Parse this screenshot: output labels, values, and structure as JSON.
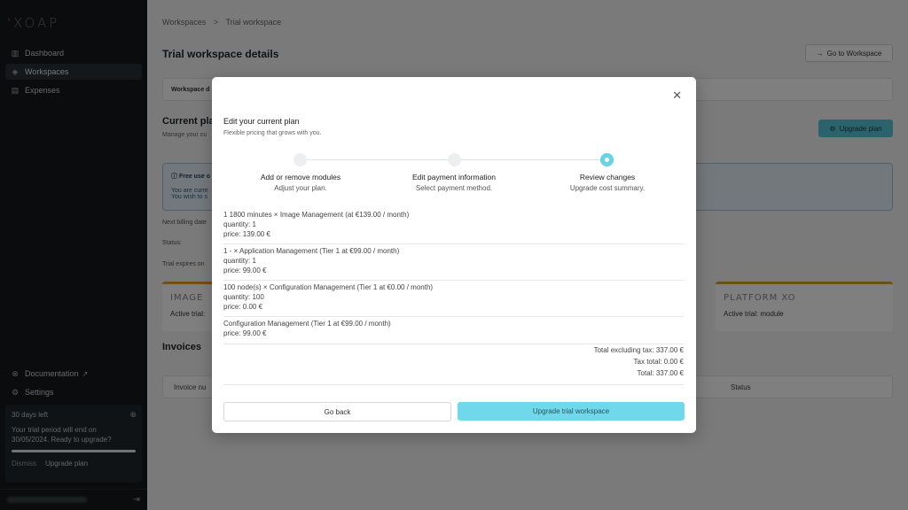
{
  "app": {
    "logo": "XOAP"
  },
  "sidebar": {
    "items": [
      {
        "label": "Dashboard"
      },
      {
        "label": "Workspaces"
      },
      {
        "label": "Expenses"
      }
    ],
    "bottom_items": [
      {
        "label": "Documentation"
      },
      {
        "label": "Settings"
      }
    ],
    "trial": {
      "days_left": "30 days left",
      "message": "Your trial period will end on 30/05/2024. Ready to upgrade?",
      "progress": 1.0,
      "dismiss": "Dismiss",
      "upgrade": "Upgrade plan"
    }
  },
  "breadcrumb": {
    "root": "Workspaces",
    "separator": ">",
    "current": "Trial workspace"
  },
  "page": {
    "title": "Trial workspace details",
    "goto_button": "Go to Workspace",
    "tab_strip": "Workspace d",
    "section_title": "Current pla",
    "section_sub": "Manage your cu",
    "upgrade_button": "Upgrade plan",
    "info_title": "Free use o",
    "info_line1": "You are curre",
    "info_line2": "You wish to s",
    "next_billing": "Next billing date",
    "status": "Status:",
    "trial_expires": "Trial expires on",
    "card_left_brand": "IMAGE",
    "card_left_text": "Active trial:",
    "card_right_brand": "PLATFORM XO",
    "card_right_text": "Active trial: module",
    "invoices_title": "Invoices",
    "invoice_col1": "Invoice nu",
    "invoice_col_status": "Status"
  },
  "modal": {
    "title": "Edit your current plan",
    "subtitle": "Flexible pricing that grows with you.",
    "steps": [
      {
        "label": "Add or remove modules",
        "desc": "Adjust your plan."
      },
      {
        "label": "Edit payment information",
        "desc": "Select payment method."
      },
      {
        "label": "Review changes",
        "desc": "Upgrade cost summary."
      }
    ],
    "items": [
      {
        "line": "1 1800 minutes × Image Management (at €139.00 / month)",
        "quantity": "quantity: 1",
        "price": "price: 139.00 €"
      },
      {
        "line": "1 - × Application Management (Tier 1 at €99.00 / month)",
        "quantity": "quantity: 1",
        "price": "price: 99.00 €"
      },
      {
        "line": "100 node(s) × Configuration Management (Tier 1 at €0.00 / month)",
        "quantity": "quantity: 100",
        "price": "price: 0.00 €"
      },
      {
        "line": "Configuration Management (Tier 1 at €99.00 / month)",
        "price": "price: 99.00 €"
      }
    ],
    "totals": {
      "excl_tax": "Total excluding tax: 337.00 €",
      "tax": "Tax total: 0.00 €",
      "total": "Total: 337.00 €"
    },
    "go_back": "Go back",
    "upgrade": "Upgrade trial workspace"
  }
}
